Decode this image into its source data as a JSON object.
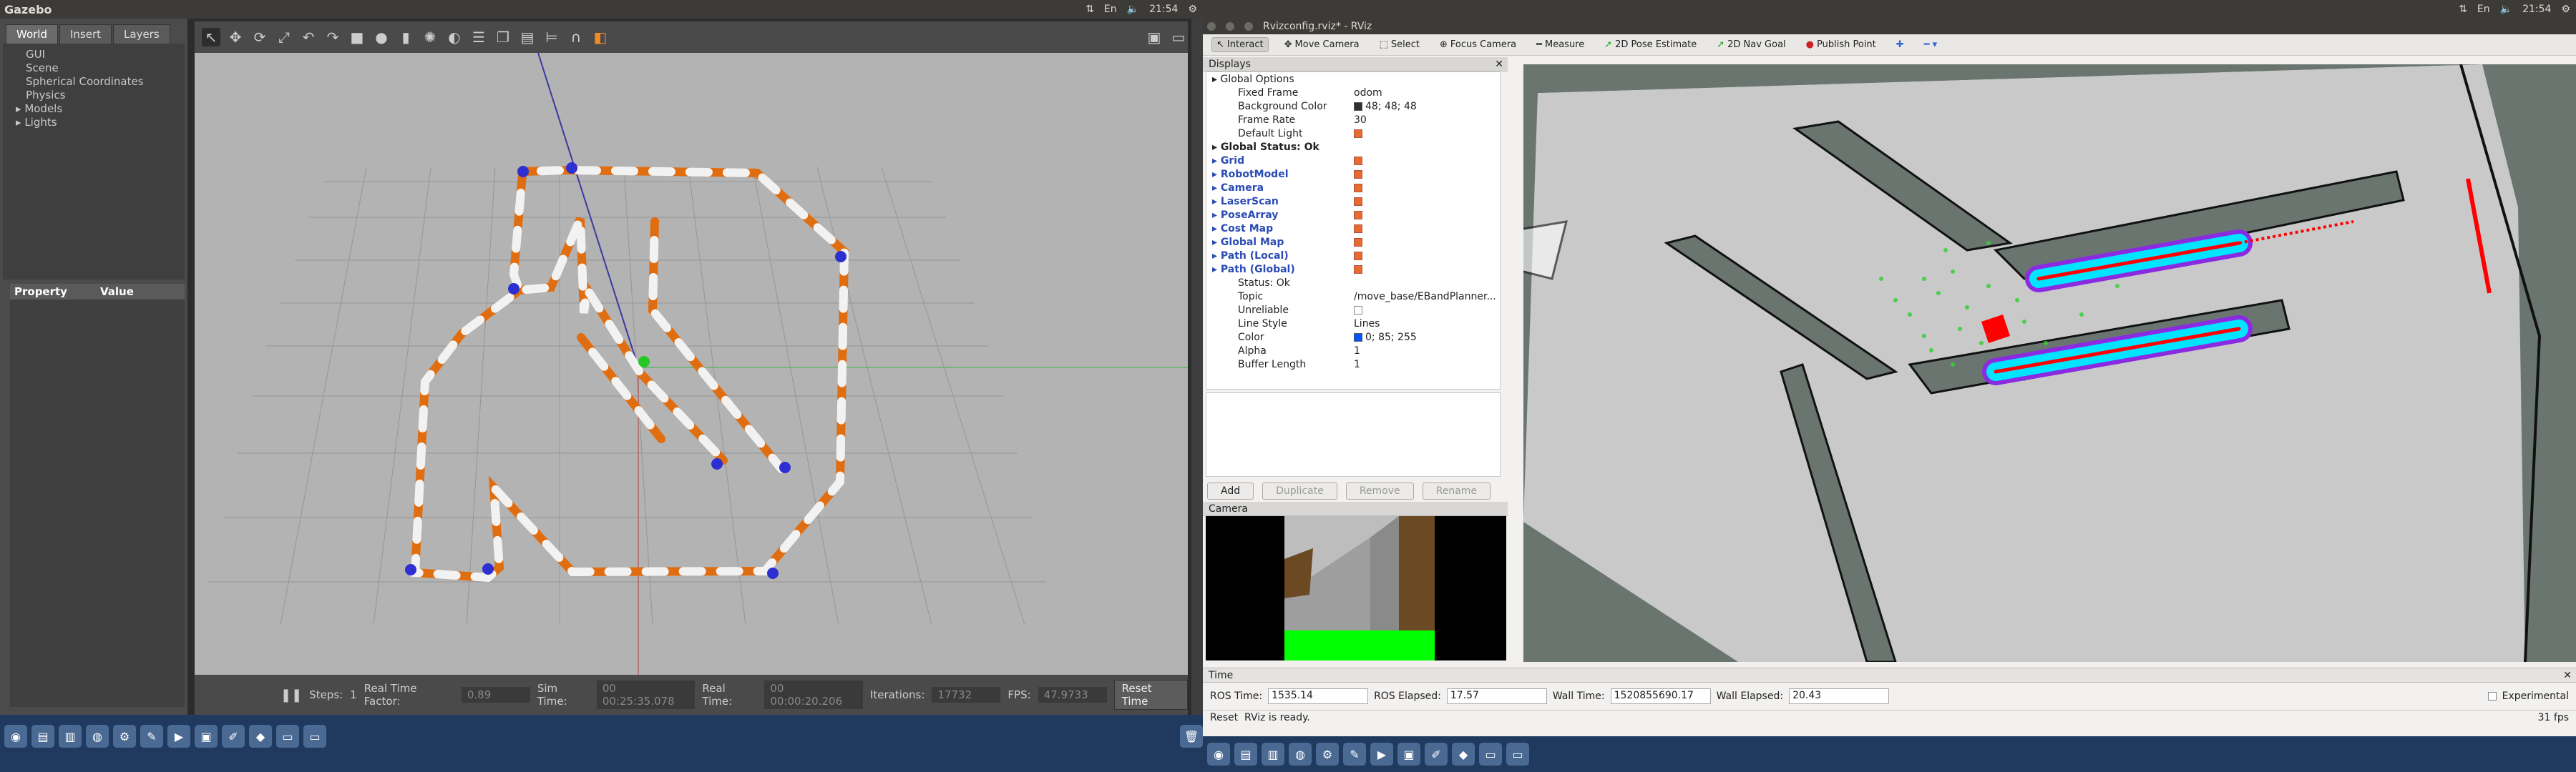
{
  "gazebo": {
    "app_title": "Gazebo",
    "clock": "21:54",
    "tabs": [
      "World",
      "Insert",
      "Layers"
    ],
    "tree": [
      "GUI",
      "Scene",
      "Spherical Coordinates",
      "Physics",
      "Models",
      "Lights"
    ],
    "prop_headers": [
      "Property",
      "Value"
    ],
    "bottom": {
      "steps_label": "Steps:",
      "steps_value": "1",
      "rtf_label": "Real Time Factor:",
      "rtf_value": "0.89",
      "sim_time_label": "Sim Time:",
      "sim_time_value": "00 00:25:35.078",
      "real_time_label": "Real Time:",
      "real_time_value": "00 00:00:20.206",
      "iterations_label": "Iterations:",
      "iterations_value": "17732",
      "fps_label": "FPS:",
      "fps_value": "47.9733",
      "reset_label": "Reset Time"
    }
  },
  "rviz": {
    "window_title": "Rvizconfig.rviz* - RViz",
    "clock": "21:54",
    "tools": [
      {
        "label": "Interact",
        "icon": "↖"
      },
      {
        "label": "Move Camera",
        "icon": "✥"
      },
      {
        "label": "Select",
        "icon": "⬚"
      },
      {
        "label": "Focus Camera",
        "icon": "⊕"
      },
      {
        "label": "Measure",
        "icon": "━"
      },
      {
        "label": "2D Pose Estimate",
        "icon": "➚"
      },
      {
        "label": "2D Nav Goal",
        "icon": "➚"
      },
      {
        "label": "Publish Point",
        "icon": "●"
      }
    ],
    "displays_title": "Displays",
    "displays": [
      {
        "name": "Global Options",
        "value": "",
        "indent": 1,
        "style": "",
        "check": ""
      },
      {
        "name": "Fixed Frame",
        "value": "odom",
        "indent": 2,
        "style": "",
        "check": ""
      },
      {
        "name": "Background Color",
        "value": "48; 48; 48",
        "indent": 2,
        "style": "",
        "check": "",
        "swatch": "#303030"
      },
      {
        "name": "Frame Rate",
        "value": "30",
        "indent": 2,
        "style": "",
        "check": ""
      },
      {
        "name": "Default Light",
        "value": "",
        "indent": 2,
        "style": "",
        "check": "on"
      },
      {
        "name": "Global Status: Ok",
        "value": "",
        "indent": 1,
        "style": "bold",
        "check": ""
      },
      {
        "name": "Grid",
        "value": "",
        "indent": 1,
        "style": "blue",
        "check": "on"
      },
      {
        "name": "RobotModel",
        "value": "",
        "indent": 1,
        "style": "blue",
        "check": "on"
      },
      {
        "name": "Camera",
        "value": "",
        "indent": 1,
        "style": "blue",
        "check": "on"
      },
      {
        "name": "LaserScan",
        "value": "",
        "indent": 1,
        "style": "blue",
        "check": "on"
      },
      {
        "name": "PoseArray",
        "value": "",
        "indent": 1,
        "style": "blue",
        "check": "on"
      },
      {
        "name": "Cost Map",
        "value": "",
        "indent": 1,
        "style": "blue",
        "check": "on"
      },
      {
        "name": "Global Map",
        "value": "",
        "indent": 1,
        "style": "blue",
        "check": "on"
      },
      {
        "name": "Path (Local)",
        "value": "",
        "indent": 1,
        "style": "blue",
        "check": "on"
      },
      {
        "name": "Path (Global)",
        "value": "",
        "indent": 1,
        "style": "blue",
        "check": "on"
      },
      {
        "name": "Status: Ok",
        "value": "",
        "indent": 2,
        "style": "",
        "check": ""
      },
      {
        "name": "Topic",
        "value": "/move_base/EBandPlanner...",
        "indent": 2,
        "style": "",
        "check": ""
      },
      {
        "name": "Unreliable",
        "value": "",
        "indent": 2,
        "style": "",
        "check": "off"
      },
      {
        "name": "Line Style",
        "value": "Lines",
        "indent": 2,
        "style": "",
        "check": ""
      },
      {
        "name": "Color",
        "value": "0; 85; 255",
        "indent": 2,
        "style": "",
        "check": "",
        "swatch": "#0055ff"
      },
      {
        "name": "Alpha",
        "value": "1",
        "indent": 2,
        "style": "",
        "check": ""
      },
      {
        "name": "Buffer Length",
        "value": "1",
        "indent": 2,
        "style": "",
        "check": ""
      }
    ],
    "buttons": [
      "Add",
      "Duplicate",
      "Remove",
      "Rename"
    ],
    "camera_title": "Camera",
    "time_title": "Time",
    "time": {
      "ros_time_label": "ROS Time:",
      "ros_time_value": "1535.14",
      "ros_elapsed_label": "ROS Elapsed:",
      "ros_elapsed_value": "17.57",
      "wall_time_label": "Wall Time:",
      "wall_time_value": "1520855690.17",
      "wall_elapsed_label": "Wall Elapsed:",
      "wall_elapsed_value": "20.43",
      "experimental_label": "Experimental"
    },
    "status": {
      "reset_label": "Reset",
      "message": "RViz is ready.",
      "fps": "31 fps"
    }
  },
  "colors": {
    "gazebo_bg": "#4b4b4b",
    "viewport": "#b3b3b3",
    "rviz_bg": "#f2f1f0",
    "checkbox_on": "#e86a2c",
    "plan_path": "#00e5ff",
    "global_path": "#ff0000"
  }
}
